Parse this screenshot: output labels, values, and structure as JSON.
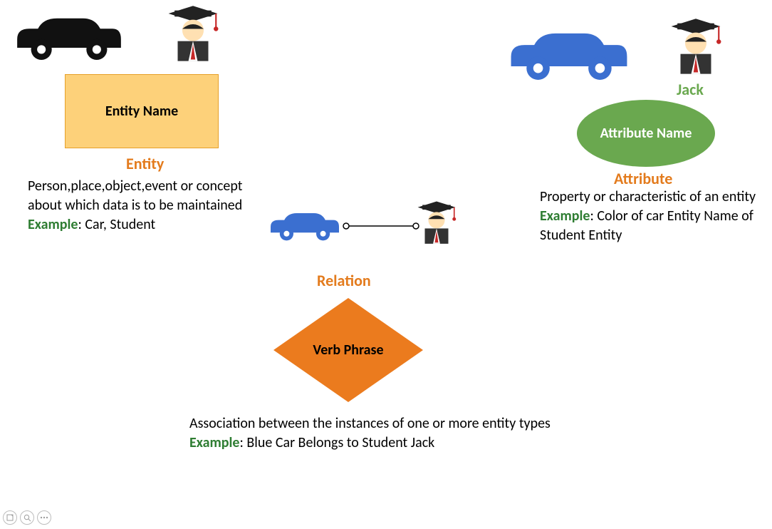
{
  "entity": {
    "shape_label": "Entity Name",
    "title": "Entity",
    "desc": "Person,place,object,event or concept about which data is to be maintained",
    "example_label": "Example",
    "example_text": ": Car, Student"
  },
  "attribute": {
    "shape_label": "Attribute Name",
    "title": "Attribute",
    "jack": "Jack",
    "desc": "Property or characteristic of an entity",
    "example_label": "Example",
    "example_text": ": Color of car Entity Name of Student Entity"
  },
  "relation": {
    "title": "Relation",
    "shape_label": "Verb Phrase",
    "desc": "Association between the instances of one or more entity types",
    "example_label": "Example",
    "example_text": ": Blue Car Belongs to Student Jack"
  },
  "colors": {
    "car_black": "#111111",
    "car_blue": "#3b6fd0",
    "orange": "#eb7b1e",
    "green": "#6aa84f",
    "yellow": "#fdd17a"
  },
  "icons": {
    "car": "car-icon",
    "student": "student-icon"
  }
}
